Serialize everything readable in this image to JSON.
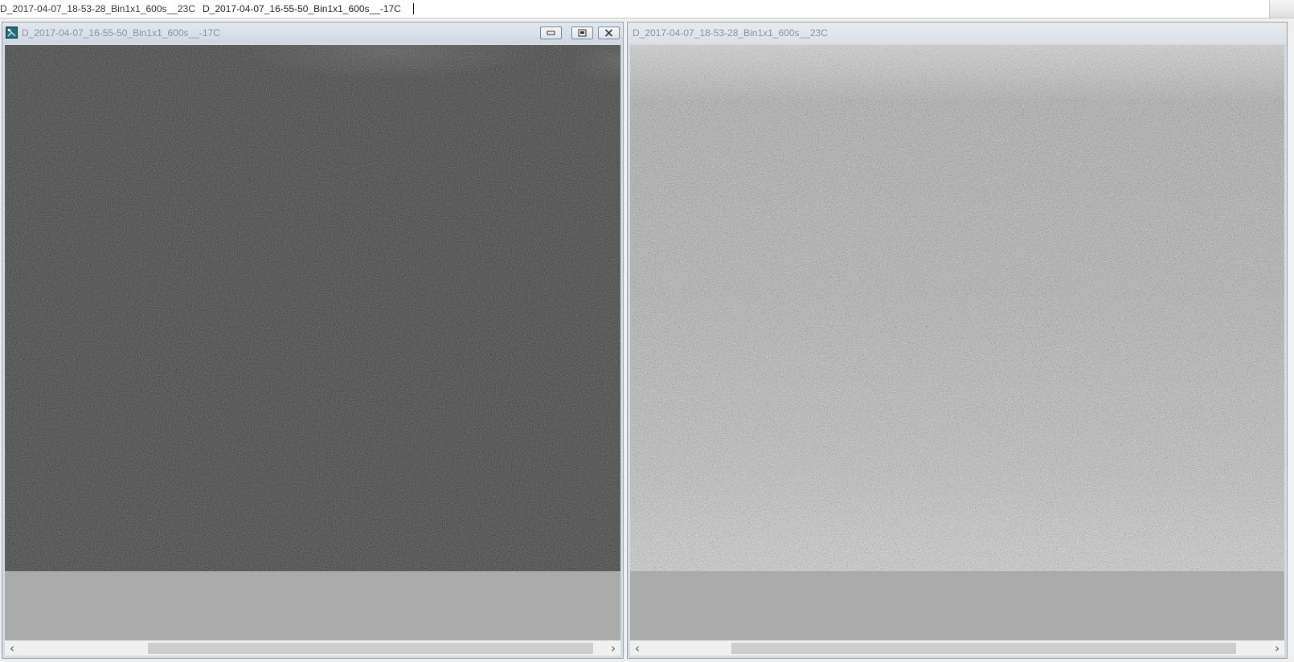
{
  "tab_bar": {
    "tabs": [
      {
        "label": "D_2017-04-07_18-53-28_Bin1x1_600s__23C",
        "active": false
      },
      {
        "label": "D_2017-04-07_16-55-50_Bin1x1_600s__-17C",
        "active": true
      }
    ]
  },
  "windows": [
    {
      "title": "D_2017-04-07_16-55-50_Bin1x1_600s__-17C",
      "active": true,
      "icon": "app-document-icon",
      "controls": [
        "minimize-icon",
        "maximize-icon",
        "close-icon"
      ],
      "image_tone": "dark",
      "hscroll": {
        "left_arrow": "‹",
        "right_arrow": "›",
        "thumb_start": 0.24,
        "thumb_end": 0.99
      }
    },
    {
      "title": "D_2017-04-07_18-53-28_Bin1x1_600s__23C",
      "active": false,
      "image_tone": "light",
      "hscroll": {
        "left_arrow": "‹",
        "right_arrow": "›",
        "thumb_start": 0.16,
        "thumb_end": 0.96
      }
    }
  ],
  "colors": {
    "canvas_gray": "#ababab",
    "dark_frame": "#383838",
    "light_frame": "#9b9b9b",
    "title_text": "#8c939b"
  }
}
